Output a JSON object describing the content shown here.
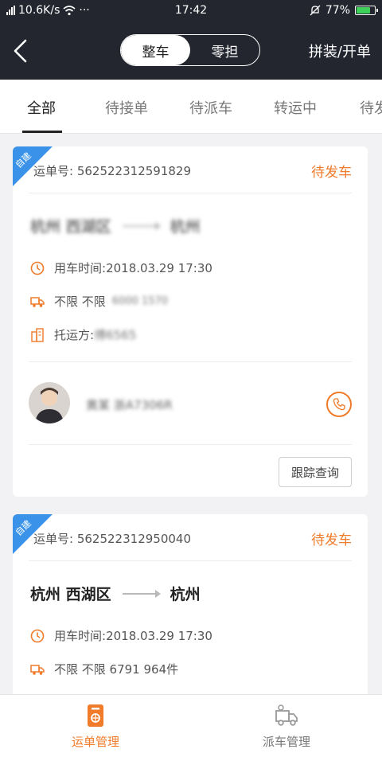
{
  "statusbar": {
    "network": "10.6K/s",
    "dots": "···",
    "time": "17:42",
    "battery": "77%",
    "battery_level": 0.77
  },
  "navbar": {
    "segments": [
      "整车",
      "零担"
    ],
    "active_segment": 0,
    "right_action": "拼装/开单"
  },
  "tabs": [
    "全部",
    "待接单",
    "待派车",
    "转运中",
    "待发"
  ],
  "colors": {
    "accent": "#f07b2a",
    "corner": "#3a93e8",
    "header": "#23262f"
  },
  "cards": [
    {
      "corner_label": "自建",
      "order_label": "运单号:",
      "order_no": "562522312591829",
      "status": "待发车",
      "route_from": "杭州 西湖区",
      "route_to": "杭州",
      "time_label": "用车时间:",
      "time": "2018.03.29 17:30",
      "cargo": "不限 不限",
      "cargo_extra": "6000 1570",
      "shipper_label": "托运方:",
      "shipper": "傅6565",
      "driver": "黄某 浙A7306R",
      "track_button": "跟踪查询"
    },
    {
      "corner_label": "自建",
      "order_label": "运单号:",
      "order_no": "562522312950040",
      "status": "待发车",
      "route_from": "杭州 西湖区",
      "route_to": "杭州",
      "time_label": "用车时间:",
      "time": "2018.03.29 17:30",
      "cargo": "不限 不限 6791 964件"
    }
  ],
  "bottom_nav": [
    {
      "label": "运单管理",
      "icon": "waybill-icon",
      "active": true
    },
    {
      "label": "派车管理",
      "icon": "truck-icon",
      "active": false
    }
  ]
}
